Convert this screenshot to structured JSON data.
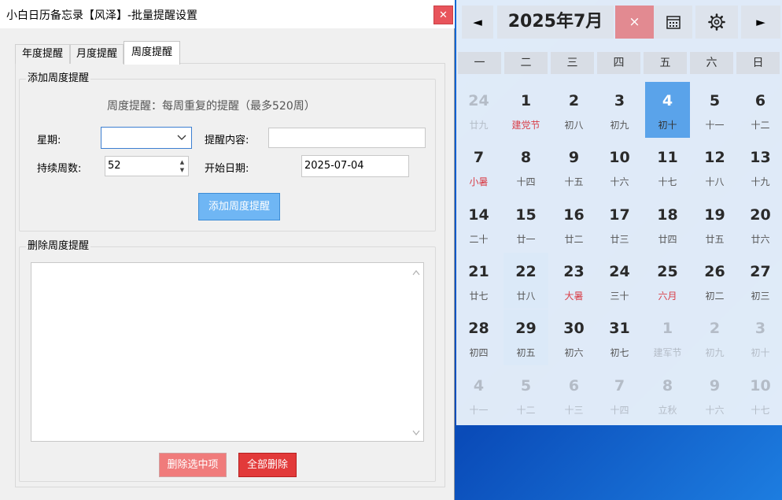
{
  "dialog": {
    "title": "小白日历备忘录【风泽】-批量提醒设置",
    "close_glyph": "✕",
    "tabs": [
      "年度提醒",
      "月度提醒",
      "周度提醒"
    ],
    "add_group": {
      "label": "添加周度提醒",
      "hint": "周度提醒：每周重复的提醒（最多520周）",
      "weekday_label": "星期:",
      "weekday_value": "",
      "content_label": "提醒内容:",
      "content_value": "",
      "weeks_label": "持续周数:",
      "weeks_value": "52",
      "start_label": "开始日期:",
      "start_value": "2025-07-04",
      "add_button": "添加周度提醒"
    },
    "delete_group": {
      "label": "删除周度提醒",
      "items": [],
      "delete_selected_button": "删除选中项",
      "delete_all_button": "全部删除"
    }
  },
  "calendar": {
    "prev_glyph": "◄",
    "next_glyph": "►",
    "title": "2025年7月",
    "close_glyph": "×",
    "weekdays": [
      "一",
      "二",
      "三",
      "四",
      "五",
      "六",
      "日"
    ],
    "weeks": [
      [
        {
          "day": "24",
          "lunar": "廿九",
          "state": "other"
        },
        {
          "day": "1",
          "lunar": "建党节",
          "state": "holiday"
        },
        {
          "day": "2",
          "lunar": "初八",
          "state": ""
        },
        {
          "day": "3",
          "lunar": "初九",
          "state": ""
        },
        {
          "day": "4",
          "lunar": "初十",
          "state": "today"
        },
        {
          "day": "5",
          "lunar": "十一",
          "state": ""
        },
        {
          "day": "6",
          "lunar": "十二",
          "state": ""
        }
      ],
      [
        {
          "day": "7",
          "lunar": "小暑",
          "state": "holiday"
        },
        {
          "day": "8",
          "lunar": "十四",
          "state": ""
        },
        {
          "day": "9",
          "lunar": "十五",
          "state": ""
        },
        {
          "day": "10",
          "lunar": "十六",
          "state": ""
        },
        {
          "day": "11",
          "lunar": "十七",
          "state": ""
        },
        {
          "day": "12",
          "lunar": "十八",
          "state": ""
        },
        {
          "day": "13",
          "lunar": "十九",
          "state": ""
        }
      ],
      [
        {
          "day": "14",
          "lunar": "二十",
          "state": ""
        },
        {
          "day": "15",
          "lunar": "廿一",
          "state": ""
        },
        {
          "day": "16",
          "lunar": "廿二",
          "state": ""
        },
        {
          "day": "17",
          "lunar": "廿三",
          "state": ""
        },
        {
          "day": "18",
          "lunar": "廿四",
          "state": ""
        },
        {
          "day": "19",
          "lunar": "廿五",
          "state": ""
        },
        {
          "day": "20",
          "lunar": "廿六",
          "state": ""
        }
      ],
      [
        {
          "day": "21",
          "lunar": "廿七",
          "state": ""
        },
        {
          "day": "22",
          "lunar": "廿八",
          "state": "highlight"
        },
        {
          "day": "23",
          "lunar": "大暑",
          "state": "holiday"
        },
        {
          "day": "24",
          "lunar": "三十",
          "state": ""
        },
        {
          "day": "25",
          "lunar": "六月",
          "state": "holiday"
        },
        {
          "day": "26",
          "lunar": "初二",
          "state": ""
        },
        {
          "day": "27",
          "lunar": "初三",
          "state": ""
        }
      ],
      [
        {
          "day": "28",
          "lunar": "初四",
          "state": ""
        },
        {
          "day": "29",
          "lunar": "初五",
          "state": "highlight"
        },
        {
          "day": "30",
          "lunar": "初六",
          "state": ""
        },
        {
          "day": "31",
          "lunar": "初七",
          "state": ""
        },
        {
          "day": "1",
          "lunar": "建军节",
          "state": "other"
        },
        {
          "day": "2",
          "lunar": "初九",
          "state": "other"
        },
        {
          "day": "3",
          "lunar": "初十",
          "state": "other"
        }
      ],
      [
        {
          "day": "4",
          "lunar": "十一",
          "state": "other"
        },
        {
          "day": "5",
          "lunar": "十二",
          "state": "other"
        },
        {
          "day": "6",
          "lunar": "十三",
          "state": "other"
        },
        {
          "day": "7",
          "lunar": "十四",
          "state": "other"
        },
        {
          "day": "8",
          "lunar": "立秋",
          "state": "other"
        },
        {
          "day": "9",
          "lunar": "十六",
          "state": "other"
        },
        {
          "day": "10",
          "lunar": "十七",
          "state": "other"
        }
      ]
    ]
  }
}
